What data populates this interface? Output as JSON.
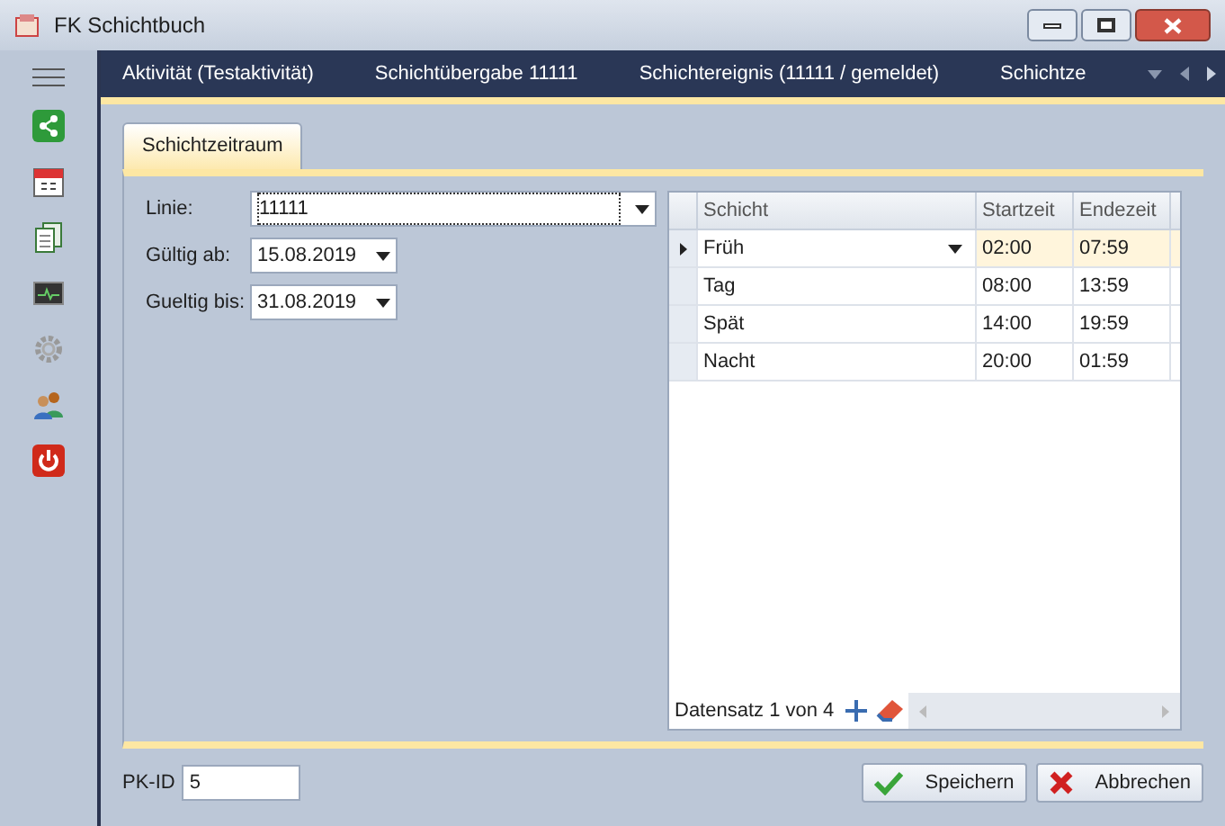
{
  "window": {
    "title": "FK Schichtbuch"
  },
  "sidebar": {
    "items": [
      {
        "kind": "share"
      },
      {
        "kind": "calendar"
      },
      {
        "kind": "pages"
      },
      {
        "kind": "monitor"
      },
      {
        "kind": "gear"
      },
      {
        "kind": "users"
      },
      {
        "kind": "power"
      }
    ]
  },
  "nav_tabs": [
    "Aktivität (Testaktivität)",
    "Schichtübergabe 11111",
    "Schichtereignis (11111 / gemeldet)",
    "Schichtze"
  ],
  "tab": {
    "label": "Schichtzeitraum",
    "selected": true
  },
  "form": {
    "fields": [
      {
        "label": "Linie:",
        "value": "11111",
        "kind": "wide"
      },
      {
        "label": "Gültig ab:",
        "value": "15.08.2019",
        "kind": "date"
      },
      {
        "label": "Gueltig bis:",
        "value": "31.08.2019",
        "kind": "date"
      }
    ]
  },
  "table": {
    "columns": [
      "Schicht",
      "Startzeit",
      "Endezeit"
    ],
    "rows": [
      {
        "cells": [
          "Früh",
          "02:00",
          "07:59"
        ],
        "selected": true
      },
      {
        "cells": [
          "Tag",
          "08:00",
          "13:59"
        ],
        "selected": false
      },
      {
        "cells": [
          "Spät",
          "14:00",
          "19:59"
        ],
        "selected": false
      },
      {
        "cells": [
          "Nacht",
          "20:00",
          "01:59"
        ],
        "selected": false
      }
    ],
    "navigator": "Datensatz 1 von 4"
  },
  "pk_id": {
    "label": "PK-ID",
    "value": "5"
  },
  "buttons": [
    {
      "label": "Speichern",
      "kind": "save"
    },
    {
      "label": "Abbrechen",
      "kind": "cancel"
    }
  ]
}
